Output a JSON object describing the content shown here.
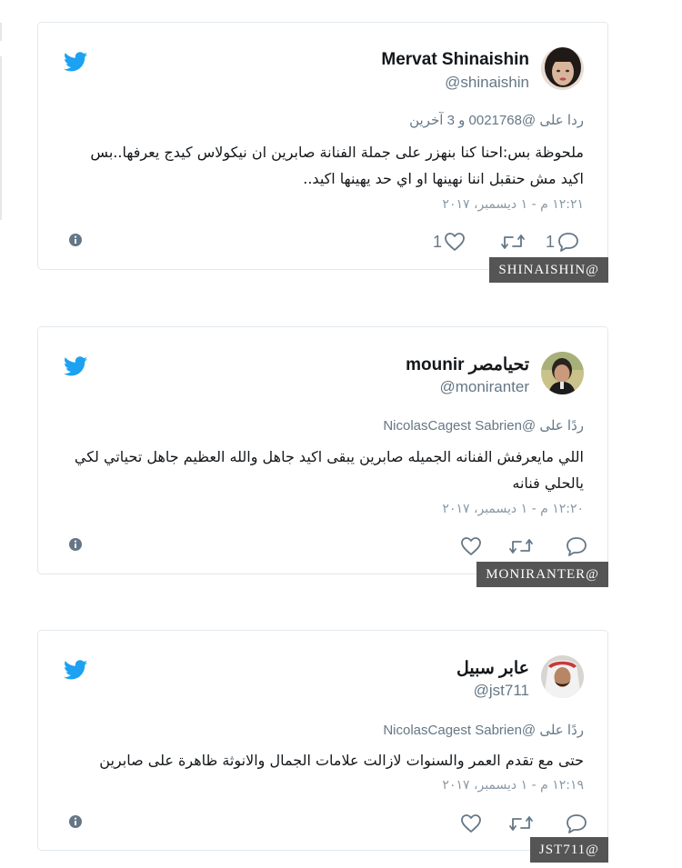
{
  "tweets": [
    {
      "name": "Mervat Shinaishin",
      "handle": "@shinaishin",
      "reply_line": "ردا على @0021768 و 3 آخرين",
      "text": "ملحوظة بس:احنا كنا بنهزر على جملة الفنانة صابرين ان نيكولاس كيدج يعرفها..بس اكيد مش حنقبل اننا نهينها او اي حد يهينها اكيد..",
      "time": "١٢:٢١ م - ١ ديسمبر، ٢٠١٧",
      "likes": "1",
      "replies": "1",
      "tag": "SHINAISHIN@"
    },
    {
      "name": "mounir تحيامصر",
      "handle": "@moniranter",
      "reply_line": "ردًا على @NicolasCagest Sabrien",
      "text": "اللي مايعرفش الفنانه الجميله صابرين يبقى اكيد جاهل والله العظيم جاهل تحياتي لكي يالحلي فنانه",
      "time": "١٢:٢٠ م - ١ ديسمبر، ٢٠١٧",
      "likes": "",
      "replies": "",
      "tag": "MONIRANTER@"
    },
    {
      "name": "عابر سبيل",
      "handle": "@jst711",
      "reply_line": "ردًا على @NicolasCagest Sabrien",
      "text": "حتى مع تقدم العمر والسنوات لازالت علامات الجمال والانوثة ظاهرة على صابرين",
      "time": "١٢:١٩ م - ١ ديسمبر، ٢٠١٧",
      "likes": "",
      "replies": "",
      "tag": "JST711@"
    }
  ],
  "colors": {
    "twitter_blue": "#1da1f2",
    "tag_bg": "#555555",
    "border": "#e1e8ed"
  },
  "icons": [
    "twitter-bird-icon",
    "info-icon",
    "heart-icon",
    "retweet-icon",
    "reply-icon"
  ]
}
